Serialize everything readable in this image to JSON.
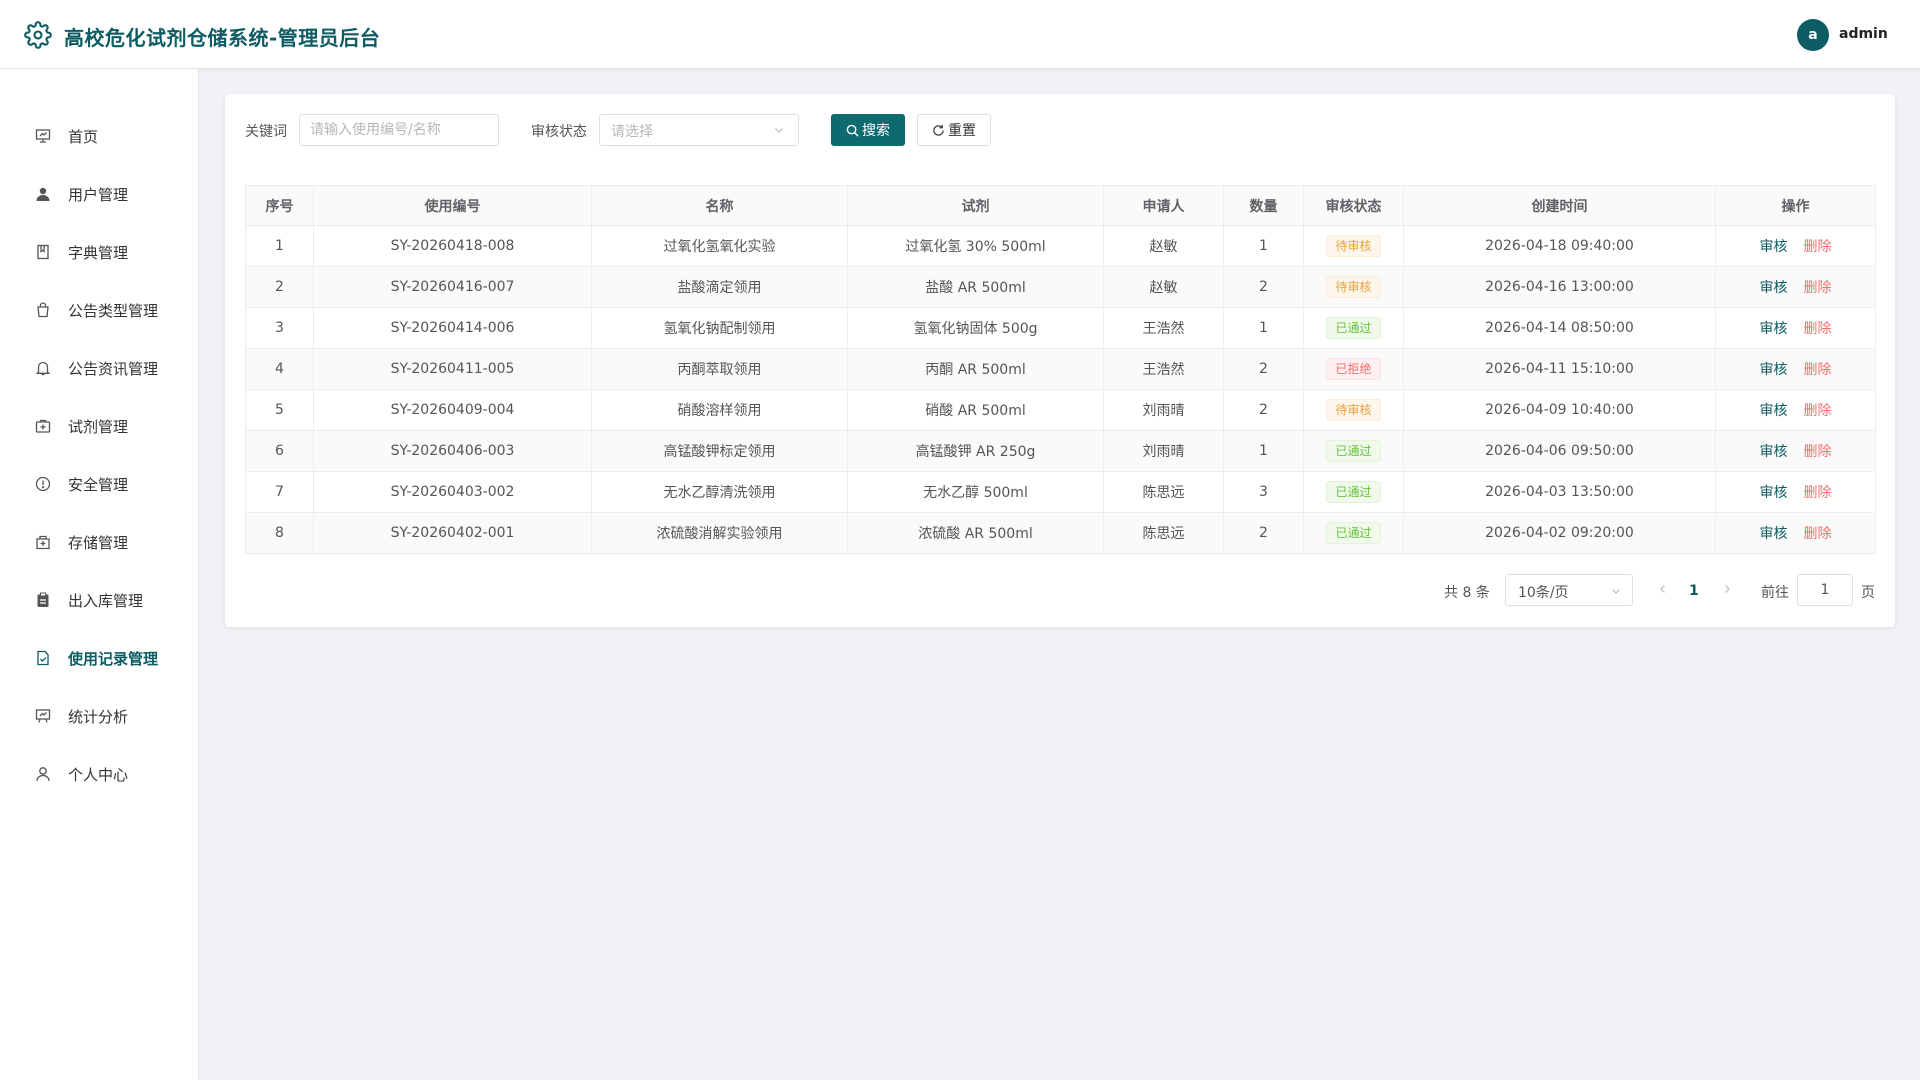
{
  "header": {
    "title": "高校危化试剂仓储系统-管理员后台",
    "avatar_letter": "a",
    "username": "admin",
    "accent": "#0d5c63"
  },
  "sidebar": {
    "items": [
      {
        "label": "首页",
        "icon": "presentation-icon"
      },
      {
        "label": "用户管理",
        "icon": "user-icon"
      },
      {
        "label": "字典管理",
        "icon": "notebook-icon"
      },
      {
        "label": "公告类型管理",
        "icon": "bag-icon"
      },
      {
        "label": "公告资讯管理",
        "icon": "bell-icon"
      },
      {
        "label": "试剂管理",
        "icon": "first-aid-icon"
      },
      {
        "label": "安全管理",
        "icon": "warning-icon"
      },
      {
        "label": "存储管理",
        "icon": "storage-icon"
      },
      {
        "label": "出入库管理",
        "icon": "clipboard-icon"
      },
      {
        "label": "使用记录管理",
        "icon": "document-check-icon",
        "active": true
      },
      {
        "label": "统计分析",
        "icon": "chart-board-icon"
      },
      {
        "label": "个人中心",
        "icon": "person-icon"
      }
    ]
  },
  "filters": {
    "keyword_label": "关键词",
    "keyword_placeholder": "请输入使用编号/名称",
    "status_label": "审核状态",
    "status_placeholder": "请选择",
    "search_button": "搜索",
    "reset_button": "重置"
  },
  "table": {
    "headers": [
      "序号",
      "使用编号",
      "名称",
      "试剂",
      "申请人",
      "数量",
      "审核状态",
      "创建时间",
      "操作"
    ],
    "rows": [
      {
        "no": "1",
        "code": "SY-20260418-008",
        "name": "过氧化氢氧化实验",
        "reagent": "过氧化氢 30% 500ml",
        "applicant": "赵敏",
        "qty": "1",
        "status": "待审核",
        "status_type": "pending",
        "created": "2026-04-18 09:40:00"
      },
      {
        "no": "2",
        "code": "SY-20260416-007",
        "name": "盐酸滴定领用",
        "reagent": "盐酸 AR 500ml",
        "applicant": "赵敏",
        "qty": "2",
        "status": "待审核",
        "status_type": "pending",
        "created": "2026-04-16 13:00:00"
      },
      {
        "no": "3",
        "code": "SY-20260414-006",
        "name": "氢氧化钠配制领用",
        "reagent": "氢氧化钠固体 500g",
        "applicant": "王浩然",
        "qty": "1",
        "status": "已通过",
        "status_type": "approved",
        "created": "2026-04-14 08:50:00"
      },
      {
        "no": "4",
        "code": "SY-20260411-005",
        "name": "丙酮萃取领用",
        "reagent": "丙酮 AR 500ml",
        "applicant": "王浩然",
        "qty": "2",
        "status": "已拒绝",
        "status_type": "rejected",
        "created": "2026-04-11 15:10:00"
      },
      {
        "no": "5",
        "code": "SY-20260409-004",
        "name": "硝酸溶样领用",
        "reagent": "硝酸 AR 500ml",
        "applicant": "刘雨晴",
        "qty": "2",
        "status": "待审核",
        "status_type": "pending",
        "created": "2026-04-09 10:40:00"
      },
      {
        "no": "6",
        "code": "SY-20260406-003",
        "name": "高锰酸钾标定领用",
        "reagent": "高锰酸钾 AR 250g",
        "applicant": "刘雨晴",
        "qty": "1",
        "status": "已通过",
        "status_type": "approved",
        "created": "2026-04-06 09:50:00"
      },
      {
        "no": "7",
        "code": "SY-20260403-002",
        "name": "无水乙醇清洗领用",
        "reagent": "无水乙醇 500ml",
        "applicant": "陈思远",
        "qty": "3",
        "status": "已通过",
        "status_type": "approved",
        "created": "2026-04-03 13:50:00"
      },
      {
        "no": "8",
        "code": "SY-20260402-001",
        "name": "浓硫酸消解实验领用",
        "reagent": "浓硫酸 AR 500ml",
        "applicant": "陈思远",
        "qty": "2",
        "status": "已通过",
        "status_type": "approved",
        "created": "2026-04-02 09:20:00"
      }
    ],
    "review_label": "审核",
    "delete_label": "删除"
  },
  "pagination": {
    "total_text": "共 8 条",
    "page_size": "10条/页",
    "current_page": "1",
    "goto_label": "前往",
    "goto_value": "1",
    "page_suffix": "页"
  }
}
